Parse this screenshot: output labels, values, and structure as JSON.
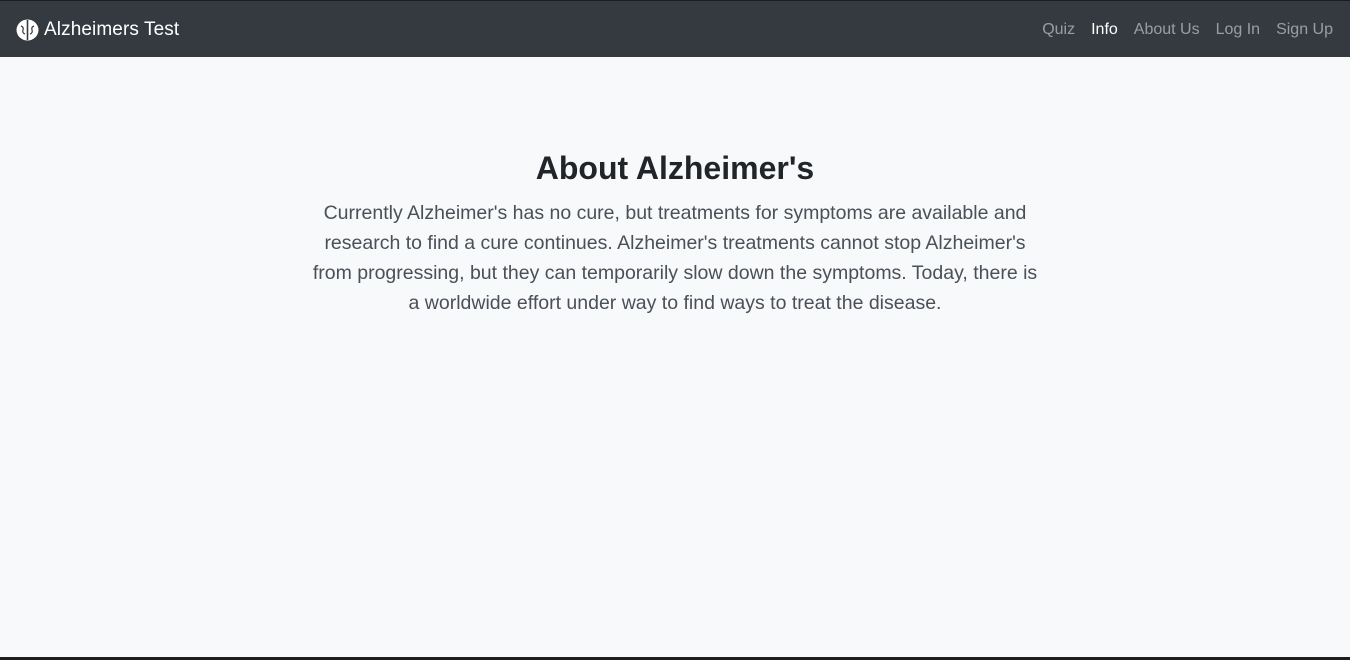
{
  "navbar": {
    "brand": {
      "icon": "brain-icon",
      "label": "Alzheimers Test"
    },
    "links": [
      {
        "label": "Quiz",
        "active": false
      },
      {
        "label": "Info",
        "active": true
      },
      {
        "label": "About Us",
        "active": false
      },
      {
        "label": "Log In",
        "active": false
      },
      {
        "label": "Sign Up",
        "active": false
      }
    ]
  },
  "main": {
    "title": "About Alzheimer's",
    "body": "Currently Alzheimer's has no cure, but treatments for symptoms are available and research to find a cure continues. Alzheimer's treatments cannot stop Alzheimer's from progressing, but they can temporarily slow down the symptoms. Today, there is a worldwide effort under way to find ways to treat the disease."
  },
  "colors": {
    "navbar_bg": "#343a40",
    "page_bg": "#f8f9fa",
    "heading": "#212529",
    "body_text": "#495057"
  }
}
